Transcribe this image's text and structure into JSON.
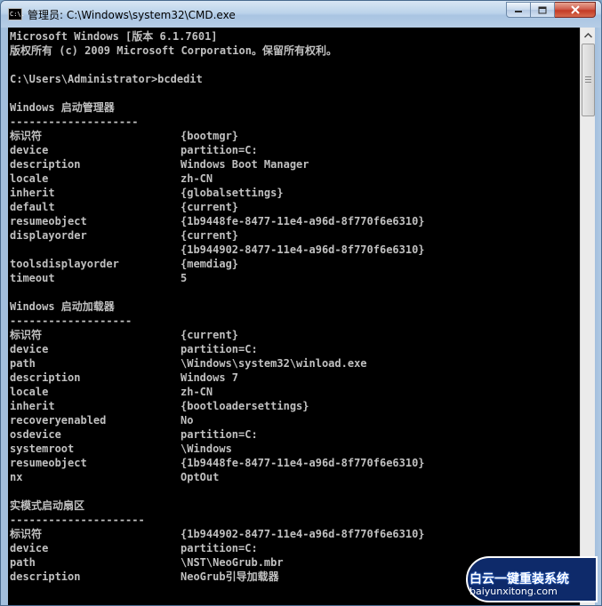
{
  "window": {
    "title": "管理员: C:\\Windows\\system32\\CMD.exe",
    "icon_label": "C:\\."
  },
  "console": {
    "header": [
      {
        "text": "Microsoft Windows [版本 6.1.7601]"
      },
      {
        "text": "版权所有 (c) 2009 Microsoft Corporation。保留所有权利。"
      },
      {
        "text": ""
      },
      {
        "text": "C:\\Users\\Administrator>bcdedit"
      }
    ],
    "sections": [
      {
        "title": "Windows 启动管理器",
        "underline": "--------------------",
        "entries": [
          {
            "key": "标识符",
            "value": "{bootmgr}"
          },
          {
            "key": "device",
            "value": "partition=C:"
          },
          {
            "key": "description",
            "value": "Windows Boot Manager"
          },
          {
            "key": "locale",
            "value": "zh-CN"
          },
          {
            "key": "inherit",
            "value": "{globalsettings}"
          },
          {
            "key": "default",
            "value": "{current}"
          },
          {
            "key": "resumeobject",
            "value": "{1b9448fe-8477-11e4-a96d-8f770f6e6310}"
          },
          {
            "key": "displayorder",
            "value": "{current}"
          },
          {
            "key": "",
            "value": "{1b944902-8477-11e4-a96d-8f770f6e6310}"
          },
          {
            "key": "toolsdisplayorder",
            "value": "{memdiag}"
          },
          {
            "key": "timeout",
            "value": "5"
          }
        ]
      },
      {
        "title": "Windows 启动加载器",
        "underline": "-------------------",
        "entries": [
          {
            "key": "标识符",
            "value": "{current}"
          },
          {
            "key": "device",
            "value": "partition=C:"
          },
          {
            "key": "path",
            "value": "\\Windows\\system32\\winload.exe"
          },
          {
            "key": "description",
            "value": "Windows 7"
          },
          {
            "key": "locale",
            "value": "zh-CN"
          },
          {
            "key": "inherit",
            "value": "{bootloadersettings}"
          },
          {
            "key": "recoveryenabled",
            "value": "No"
          },
          {
            "key": "osdevice",
            "value": "partition=C:"
          },
          {
            "key": "systemroot",
            "value": "\\Windows"
          },
          {
            "key": "resumeobject",
            "value": "{1b9448fe-8477-11e4-a96d-8f770f6e6310}"
          },
          {
            "key": "nx",
            "value": "OptOut"
          }
        ]
      },
      {
        "title": "实模式启动扇区",
        "underline": "---------------------",
        "entries": [
          {
            "key": "标识符",
            "value": "{1b944902-8477-11e4-a96d-8f770f6e6310}"
          },
          {
            "key": "device",
            "value": "partition=C:"
          },
          {
            "key": "path",
            "value": "\\NST\\NeoGrub.mbr"
          },
          {
            "key": "description",
            "value": "NeoGrub引导加载器"
          }
        ]
      }
    ]
  },
  "watermark": {
    "brand": "白云一键重装系统",
    "url": "baiyunxitong.com"
  },
  "colors": {
    "console_bg": "#000000",
    "console_text": "#c0c0c0",
    "close_button": "#c33b25"
  }
}
